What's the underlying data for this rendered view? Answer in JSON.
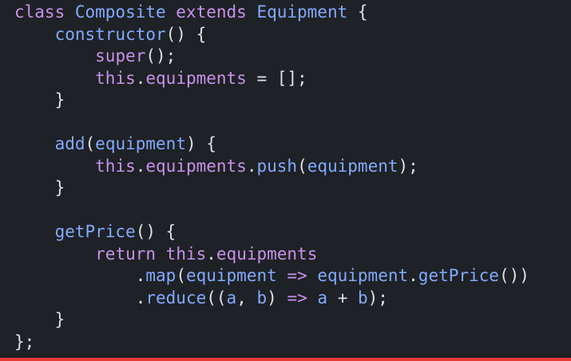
{
  "code": {
    "language": "javascript",
    "lines": [
      [
        {
          "t": "class ",
          "c": "keyword"
        },
        {
          "t": "Composite",
          "c": "class"
        },
        {
          "t": " extends ",
          "c": "keyword"
        },
        {
          "t": "Equipment",
          "c": "class"
        },
        {
          "t": " {",
          "c": "punct"
        }
      ],
      [
        {
          "t": "    ",
          "c": "text"
        },
        {
          "t": "constructor",
          "c": "func"
        },
        {
          "t": "() {",
          "c": "punct"
        }
      ],
      [
        {
          "t": "        ",
          "c": "text"
        },
        {
          "t": "super",
          "c": "keyword"
        },
        {
          "t": "();",
          "c": "punct"
        }
      ],
      [
        {
          "t": "        ",
          "c": "text"
        },
        {
          "t": "this",
          "c": "keyword"
        },
        {
          "t": ".",
          "c": "punct"
        },
        {
          "t": "equipments",
          "c": "member"
        },
        {
          "t": " = [];",
          "c": "punct"
        }
      ],
      [
        {
          "t": "    }",
          "c": "punct"
        }
      ],
      [
        {
          "t": "",
          "c": "text"
        }
      ],
      [
        {
          "t": "    ",
          "c": "text"
        },
        {
          "t": "add",
          "c": "func"
        },
        {
          "t": "(",
          "c": "punct"
        },
        {
          "t": "equipment",
          "c": "class"
        },
        {
          "t": ") {",
          "c": "punct"
        }
      ],
      [
        {
          "t": "        ",
          "c": "text"
        },
        {
          "t": "this",
          "c": "keyword"
        },
        {
          "t": ".",
          "c": "punct"
        },
        {
          "t": "equipments",
          "c": "member"
        },
        {
          "t": ".",
          "c": "punct"
        },
        {
          "t": "push",
          "c": "func"
        },
        {
          "t": "(",
          "c": "punct"
        },
        {
          "t": "equipment",
          "c": "class"
        },
        {
          "t": ");",
          "c": "punct"
        }
      ],
      [
        {
          "t": "    }",
          "c": "punct"
        }
      ],
      [
        {
          "t": "",
          "c": "text"
        }
      ],
      [
        {
          "t": "    ",
          "c": "text"
        },
        {
          "t": "getPrice",
          "c": "func"
        },
        {
          "t": "() {",
          "c": "punct"
        }
      ],
      [
        {
          "t": "        ",
          "c": "text"
        },
        {
          "t": "return ",
          "c": "keyword"
        },
        {
          "t": "this",
          "c": "keyword"
        },
        {
          "t": ".",
          "c": "punct"
        },
        {
          "t": "equipments",
          "c": "member"
        }
      ],
      [
        {
          "t": "            .",
          "c": "punct"
        },
        {
          "t": "map",
          "c": "func"
        },
        {
          "t": "(",
          "c": "punct"
        },
        {
          "t": "equipment",
          "c": "class"
        },
        {
          "t": " => ",
          "c": "keyword"
        },
        {
          "t": "equipment",
          "c": "class"
        },
        {
          "t": ".",
          "c": "punct"
        },
        {
          "t": "getPrice",
          "c": "func"
        },
        {
          "t": "())",
          "c": "punct"
        }
      ],
      [
        {
          "t": "            .",
          "c": "punct"
        },
        {
          "t": "reduce",
          "c": "func"
        },
        {
          "t": "((",
          "c": "punct"
        },
        {
          "t": "a",
          "c": "class"
        },
        {
          "t": ", ",
          "c": "punct"
        },
        {
          "t": "b",
          "c": "class"
        },
        {
          "t": ") ",
          "c": "punct"
        },
        {
          "t": "=>",
          "c": "keyword"
        },
        {
          "t": " ",
          "c": "text"
        },
        {
          "t": "a",
          "c": "class"
        },
        {
          "t": " + ",
          "c": "punct"
        },
        {
          "t": "b",
          "c": "class"
        },
        {
          "t": ");",
          "c": "punct"
        }
      ],
      [
        {
          "t": "    }",
          "c": "punct"
        }
      ],
      [
        {
          "t": "};",
          "c": "punct"
        }
      ]
    ]
  },
  "colors": {
    "background": "#1e2125",
    "keyword": "#c792ea",
    "class": "#82aaff",
    "function": "#82aaff",
    "member": "#c792ea",
    "text": "#dde1e6",
    "progress": "#e53935"
  },
  "progress": {
    "fraction": 1.0
  }
}
